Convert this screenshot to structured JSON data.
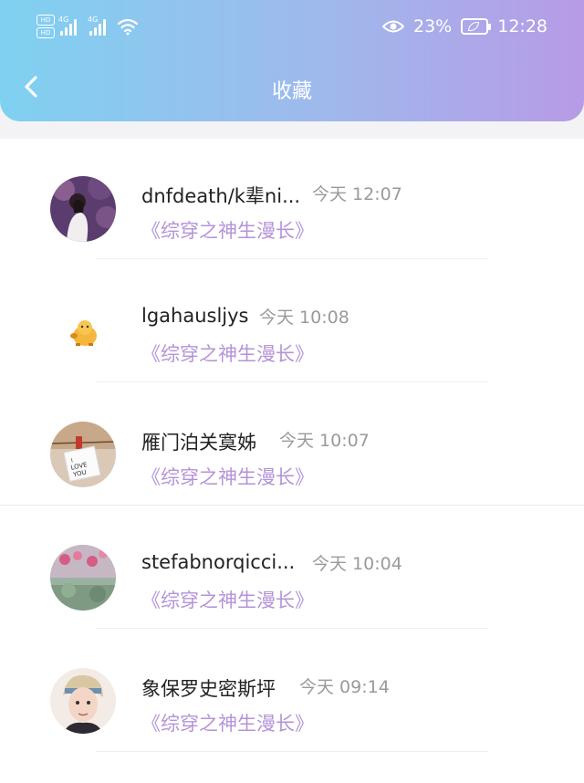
{
  "status_bar": {
    "hd1": "HD",
    "hd2": "HD",
    "net1": "4G",
    "net2": "4G",
    "battery_percent": "23%",
    "time": "12:28"
  },
  "header": {
    "title": "收藏"
  },
  "list": [
    {
      "name": "dnfdeath/k辈ni...",
      "time": "今天 12:07",
      "book": "《综穿之神生漫长》"
    },
    {
      "name": "lgahausljys",
      "time": "今天 10:08",
      "book": "《综穿之神生漫长》"
    },
    {
      "name": "雁门泊关寞姊",
      "time": "今天 10:07",
      "book": "《综穿之神生漫长》"
    },
    {
      "name": "stefabnorqicci...",
      "time": "今天 10:04",
      "book": "《综穿之神生漫长》"
    },
    {
      "name": "象保罗史密斯坪",
      "time": "今天 09:14",
      "book": "《综穿之神生漫长》"
    }
  ],
  "colors": {
    "header_start": "#7fd1f1",
    "header_end": "#b79be6",
    "book_title": "#b493d8",
    "timestamp": "#9a9a9a"
  }
}
